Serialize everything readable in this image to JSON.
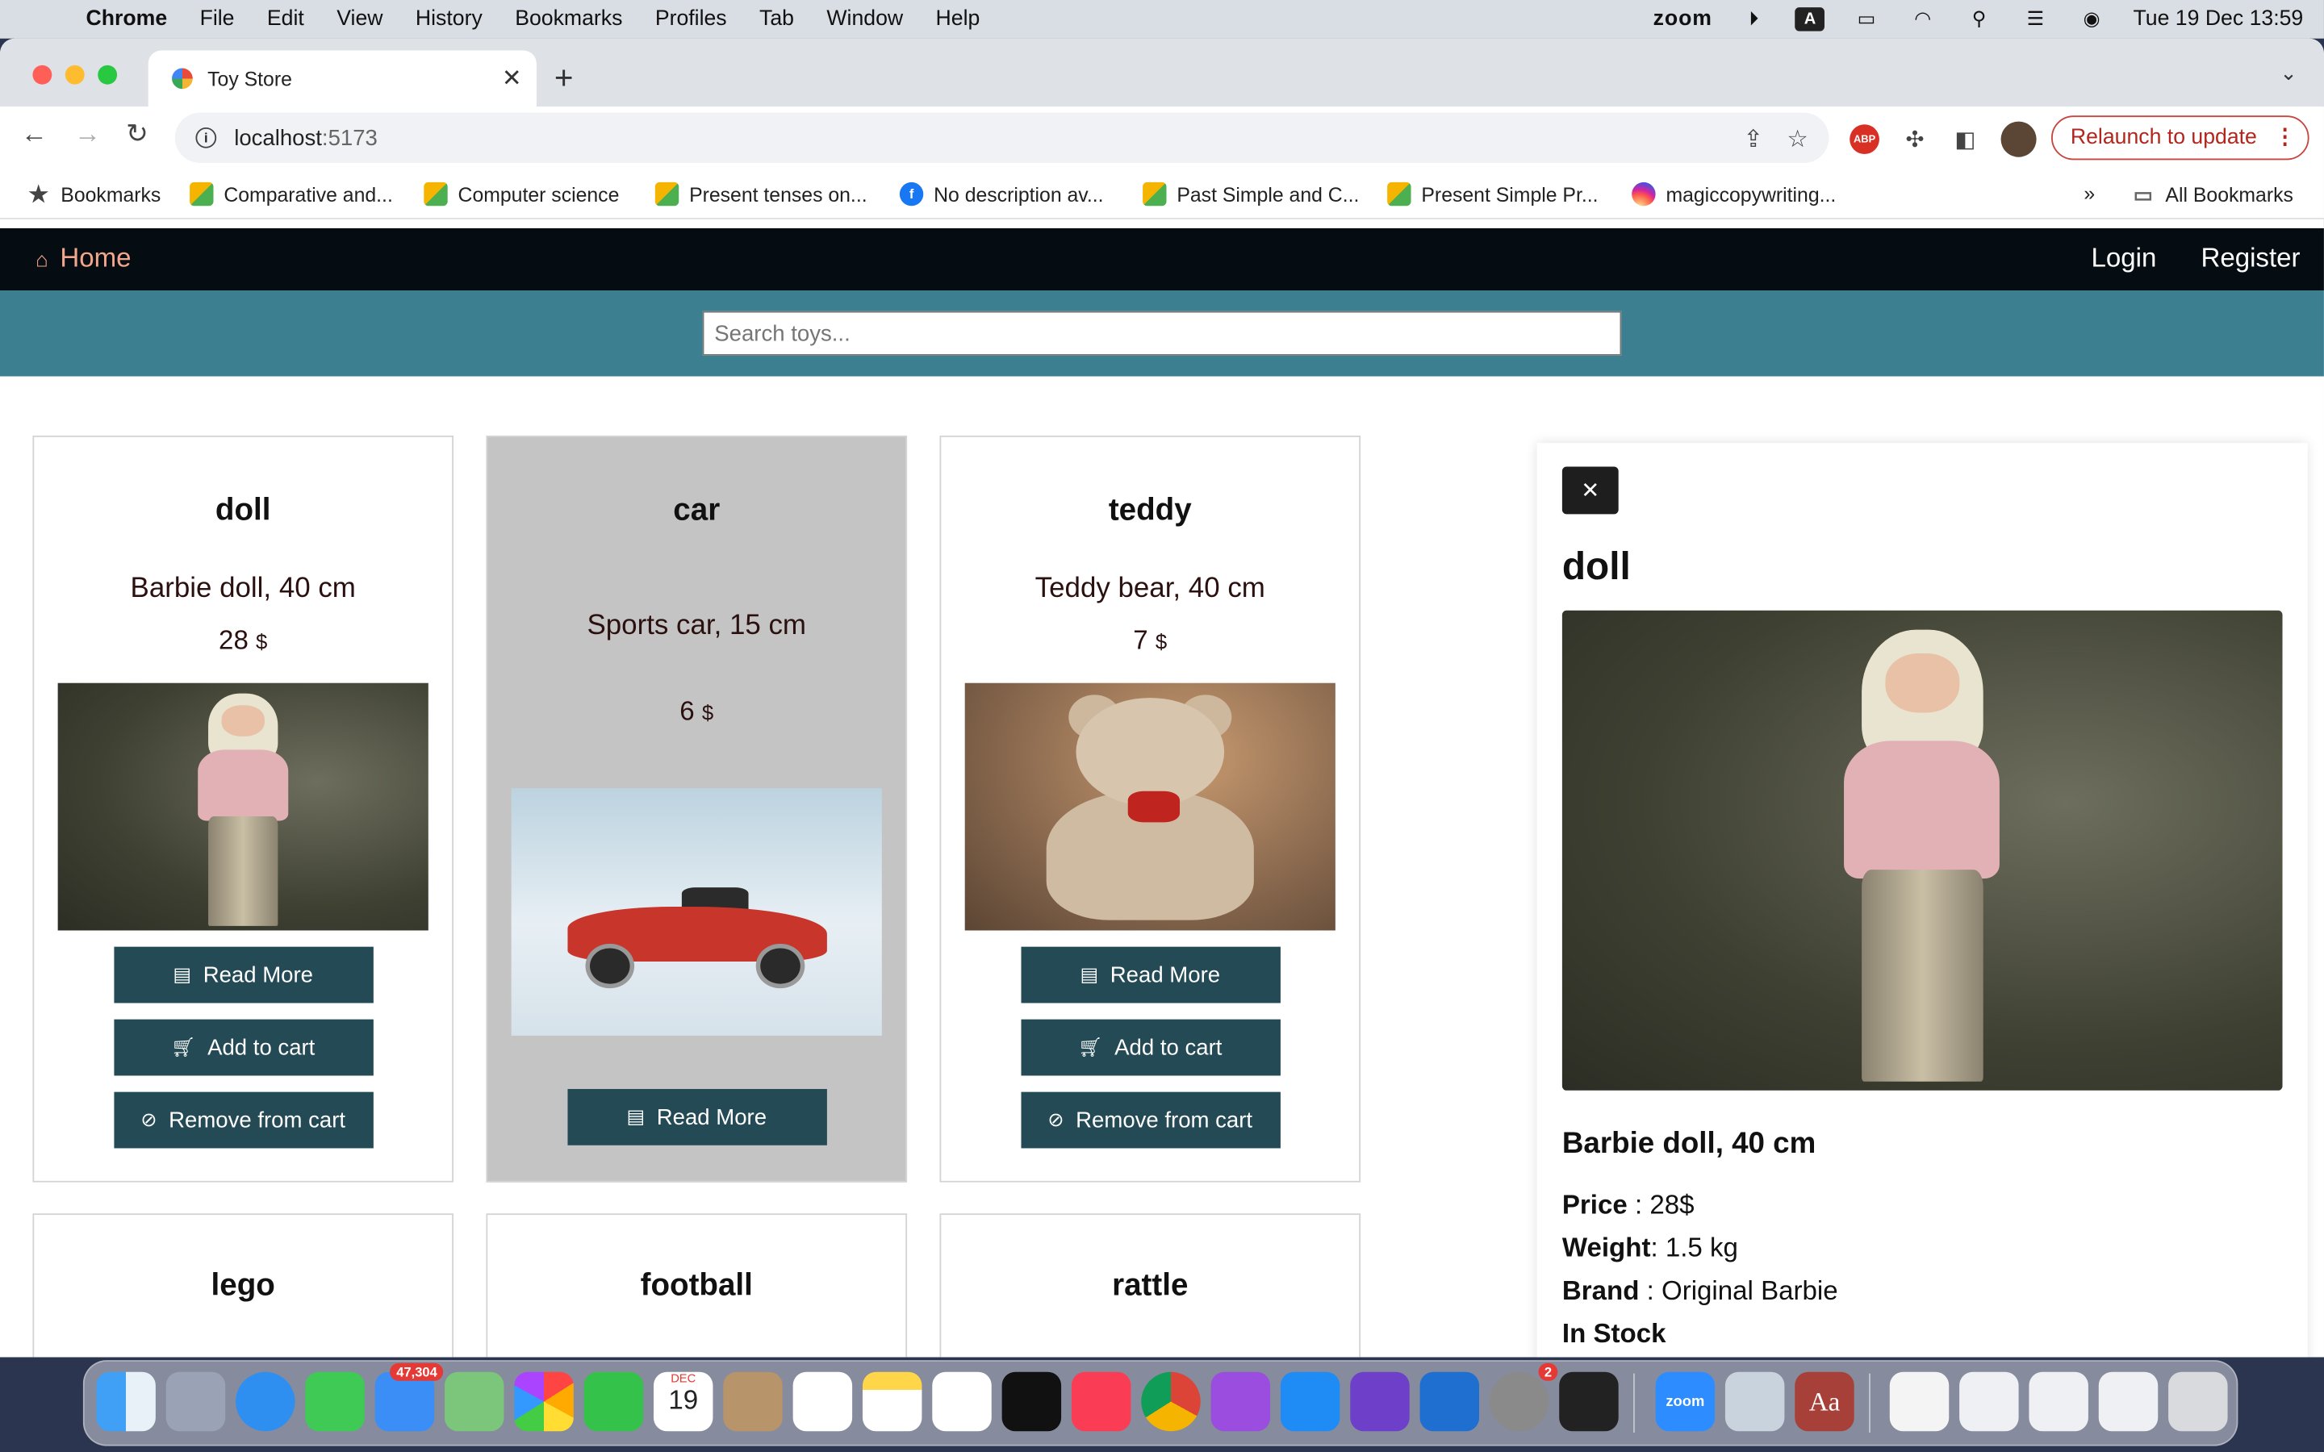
{
  "menubar": {
    "app_name": "Chrome",
    "items": [
      "File",
      "Edit",
      "View",
      "History",
      "Bookmarks",
      "Profiles",
      "Tab",
      "Window",
      "Help"
    ],
    "zoom_label": "zoom",
    "datetime": "Tue 19 Dec  13:59",
    "input_source": "A"
  },
  "browser": {
    "tab_title": "Toy Store",
    "url_host": "localhost",
    "url_port": ":5173",
    "relaunch_label": "Relaunch to update",
    "bookmarks": [
      {
        "label": "Bookmarks",
        "icon": "star-icon"
      },
      {
        "label": "Comparative and...",
        "icon": "grid-icon"
      },
      {
        "label": "Computer science",
        "icon": "grid-icon"
      },
      {
        "label": "Present tenses on...",
        "icon": "grid-icon"
      },
      {
        "label": "No description av...",
        "icon": "facebook-icon"
      },
      {
        "label": "Past Simple and C...",
        "icon": "grid-icon"
      },
      {
        "label": "Present Simple Pr...",
        "icon": "grid-icon"
      },
      {
        "label": "magiccopywriting...",
        "icon": "instagram-icon"
      }
    ],
    "all_bookmarks_label": "All Bookmarks",
    "overflow_label": "»"
  },
  "site": {
    "nav": {
      "home_label": "Home",
      "login_label": "Login",
      "register_label": "Register"
    },
    "search": {
      "placeholder": "Search toys..."
    },
    "currency_symbol": "$",
    "buttons": {
      "read_more": "Read More",
      "add_to_cart": "Add to cart",
      "remove_from_cart": "Remove from cart"
    },
    "products": [
      {
        "name": "doll",
        "description": "Barbie doll, 40 cm",
        "price": "28",
        "image": "doll-photo",
        "selected": false
      },
      {
        "name": "car",
        "description": "Sports car, 15 cm",
        "price": "6",
        "image": "red-car-photo",
        "selected": true
      },
      {
        "name": "teddy",
        "description": "Teddy bear, 40 cm",
        "price": "7",
        "image": "teddy-bear-photo",
        "selected": false
      },
      {
        "name": "lego"
      },
      {
        "name": "football"
      },
      {
        "name": "rattle"
      }
    ],
    "detail": {
      "title": "doll",
      "subtitle": "Barbie doll, 40 cm",
      "price_label": "Price",
      "price_value": " : 28$",
      "weight_label": "Weight",
      "weight_value": ": 1.5 kg",
      "brand_label": "Brand",
      "brand_value": " : Original Barbie",
      "stock": "In Stock",
      "close_symbol": "✕"
    }
  },
  "dock": {
    "mail_badge": "47,304",
    "calendar_month": "DEC",
    "calendar_day": "19",
    "settings_badge": "2",
    "zoom_label": "zoom",
    "dictionary_label": "Aa"
  },
  "colors": {
    "navbar": "#050d12",
    "search_band": "#3b7f91",
    "button": "#234a55",
    "home_link": "#f1a78b",
    "selected_card": "#c4c4c4"
  }
}
